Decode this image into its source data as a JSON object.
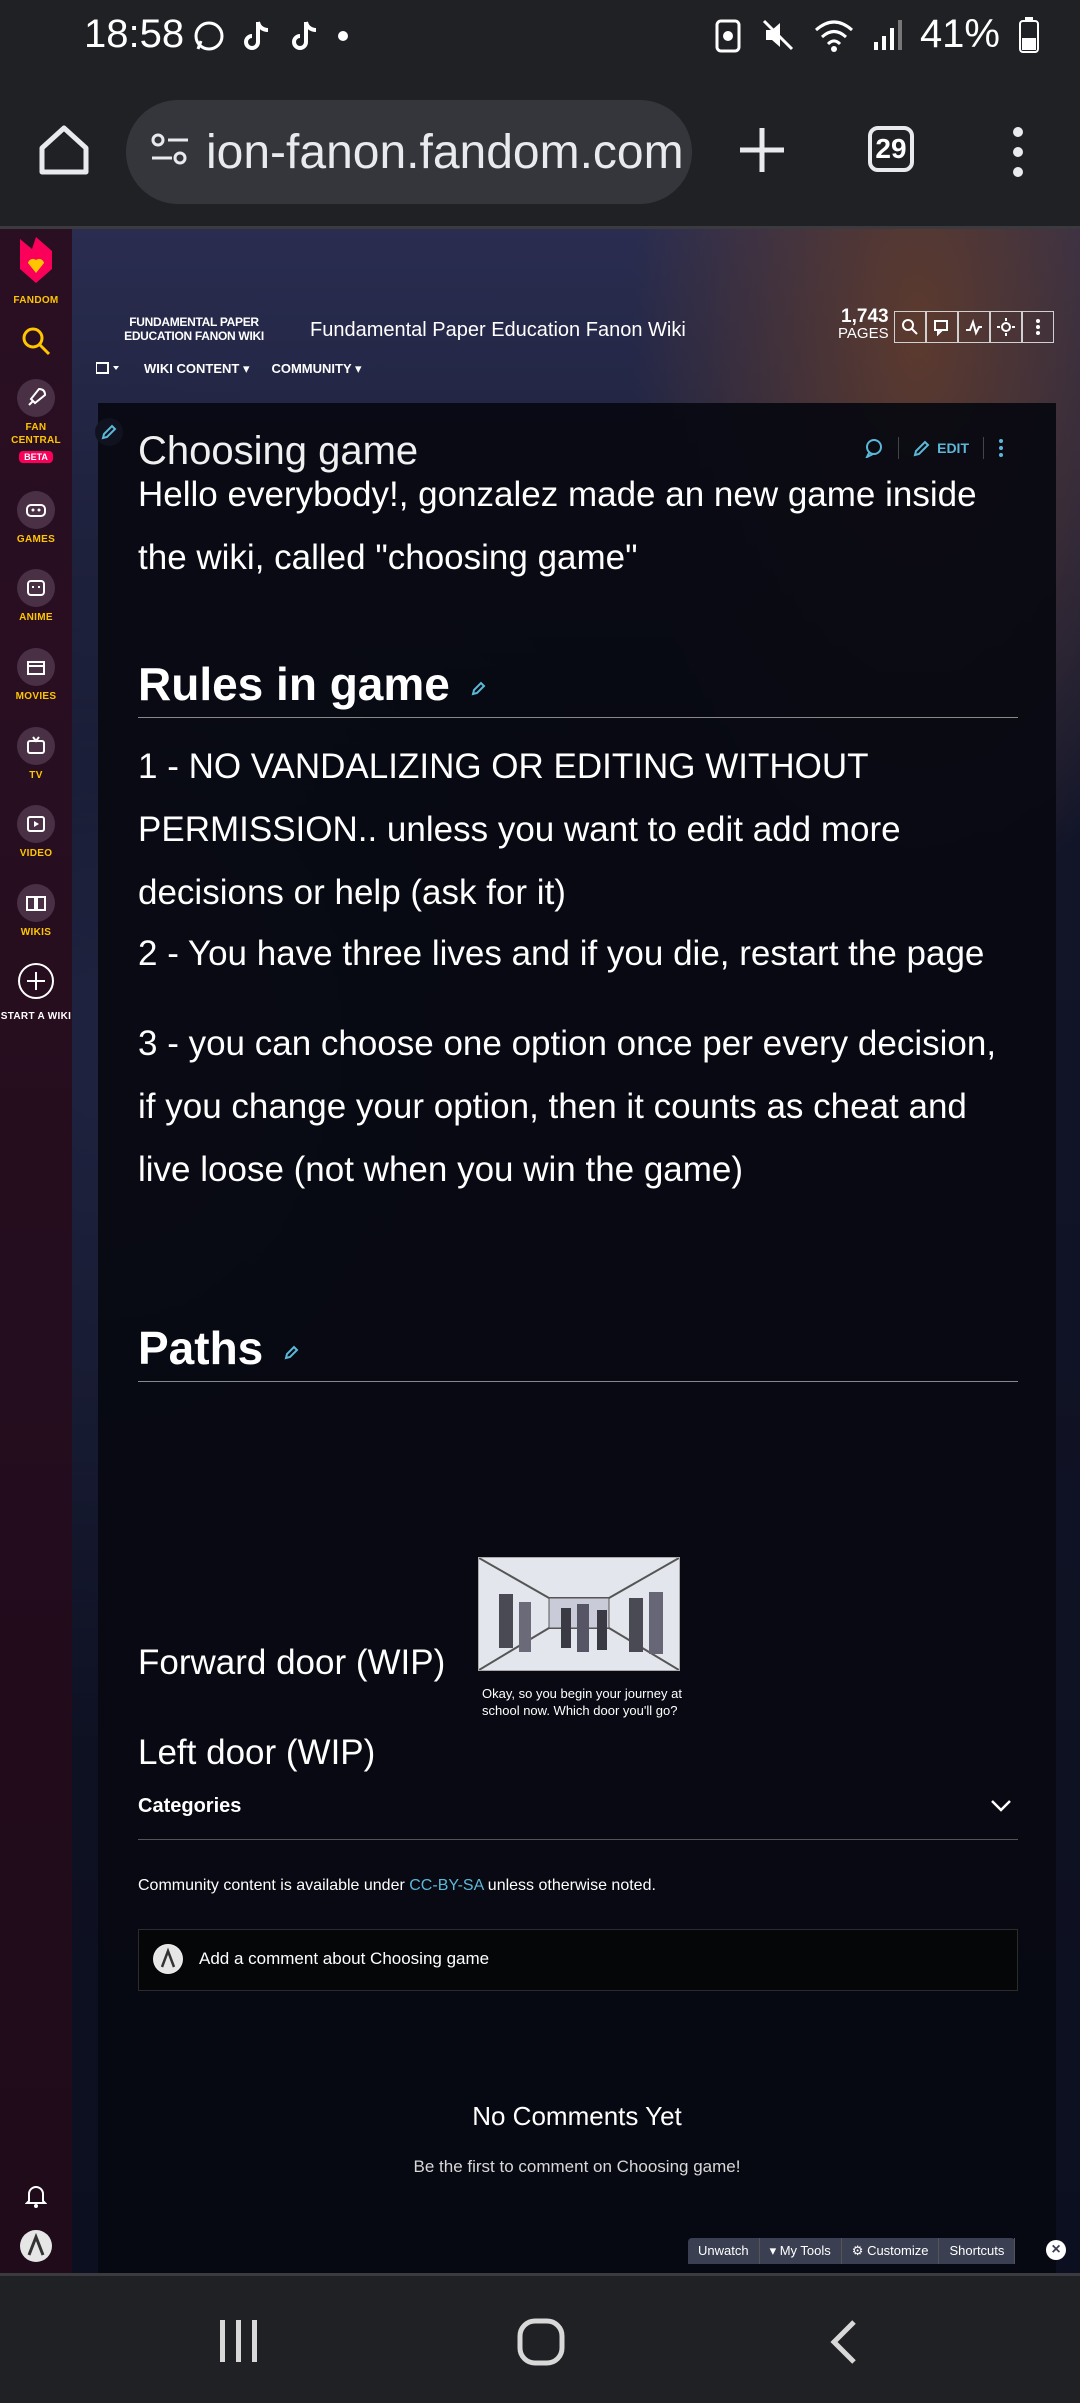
{
  "status_bar": {
    "time": "18:58",
    "battery": "41%"
  },
  "browser": {
    "url": "ion-fanon.fandom.com",
    "tab_count": "29"
  },
  "fandom_rail": {
    "logo_label": "FANDOM",
    "items": [
      {
        "label": "FAN CENTRAL",
        "badge": "BETA"
      },
      {
        "label": "GAMES"
      },
      {
        "label": "ANIME"
      },
      {
        "label": "MOVIES"
      },
      {
        "label": "TV"
      },
      {
        "label": "VIDEO"
      },
      {
        "label": "WIKIS"
      },
      {
        "label": "START A WIKI"
      }
    ]
  },
  "wiki": {
    "logo_text": "FUNDAMENTAL PAPER EDUCATION FANON WIKI",
    "name": "Fundamental Paper Education Fanon Wiki",
    "pages_count": "1,743",
    "pages_label": "PAGES",
    "nav": [
      "WIKI CONTENT",
      "COMMUNITY"
    ]
  },
  "article": {
    "title": "Choosing game",
    "edit_label": "EDIT",
    "intro": "Hello everybody!, gonzalez made an new game inside the wiki, called \"choosing game\"",
    "rules_heading": "Rules in game",
    "rules": [
      "1 - NO VANDALIZING OR EDITING WITHOUT PERMISSION.. unless you want to edit add more decisions or help (ask for it)",
      "2 - You have three lives and if you die, restart the page",
      "3 - you can choose one option once per every decision, if you change your option, then it counts as cheat and live loose (not when you win the game)"
    ],
    "paths_heading": "Paths",
    "image_caption": "Okay, so you begin your journey at school now. Which door you'll go?",
    "paths": [
      "Forward door (WIP)",
      "Left door (WIP)"
    ],
    "categories_label": "Categories",
    "license_prefix": "Community content is available under ",
    "license_link": "CC-BY-SA",
    "license_suffix": " unless otherwise noted.",
    "comment_placeholder": "Add a comment about Choosing game",
    "no_comments_title": "No Comments Yet",
    "no_comments_sub": "Be the first to comment on Choosing game!"
  },
  "toolbar": {
    "items": [
      "Unwatch",
      "My Tools",
      "Customize",
      "Shortcuts"
    ]
  },
  "colors": {
    "accent_link": "#5bb8d8",
    "fandom_yellow": "#ffc500",
    "fandom_pink": "#fa005a"
  }
}
